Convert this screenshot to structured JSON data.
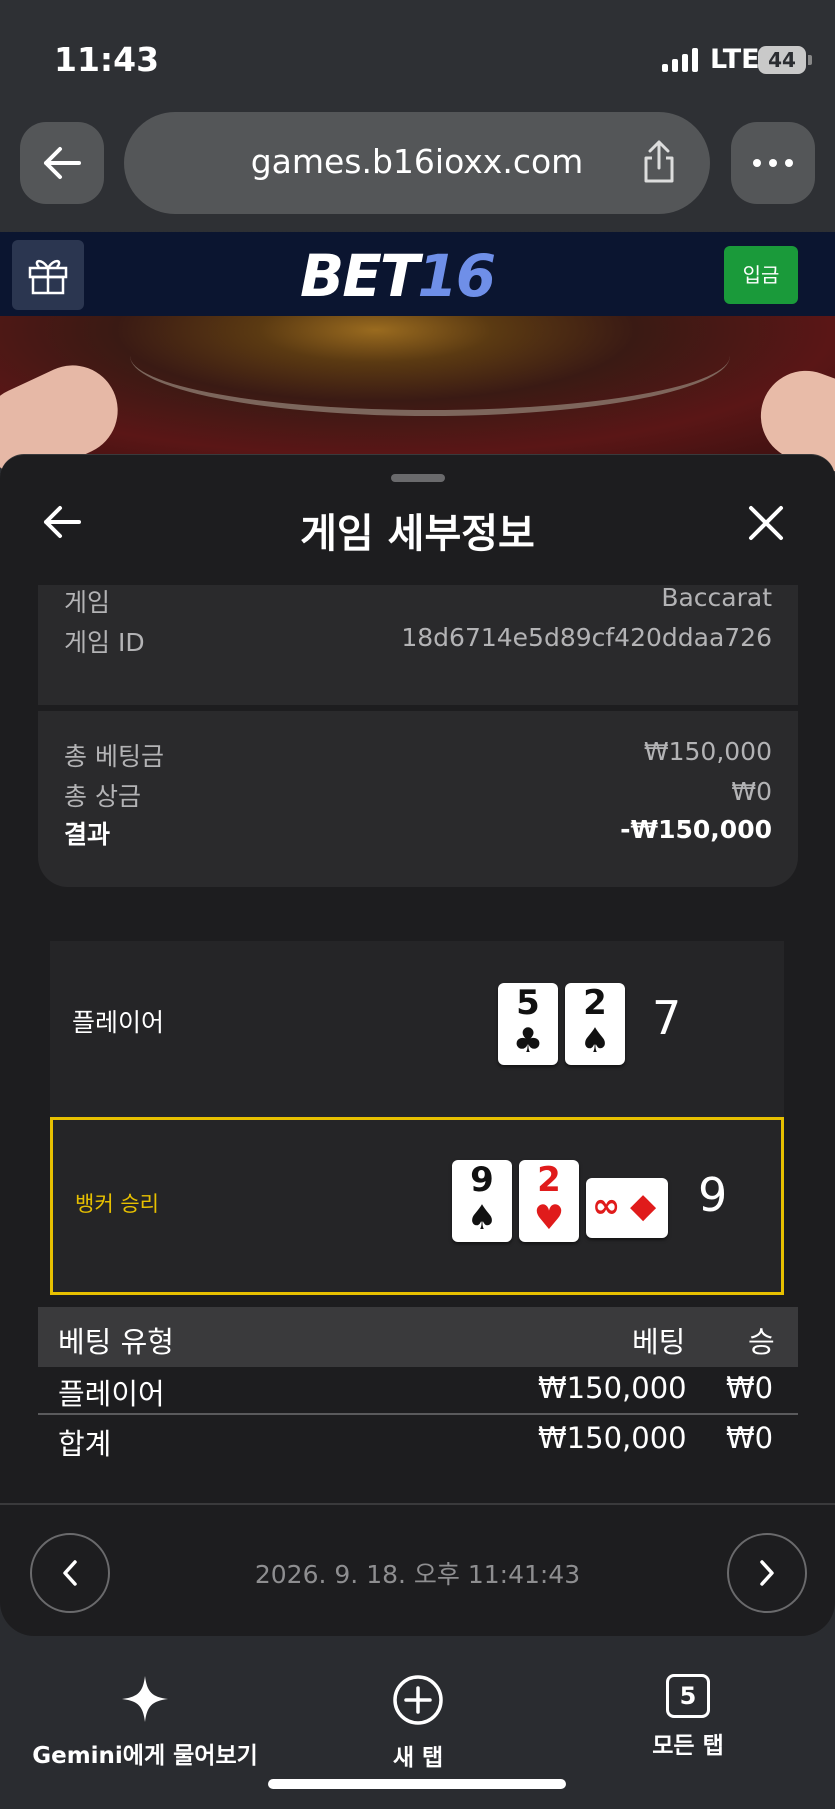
{
  "status_bar": {
    "time": "11:43",
    "network": "LTE",
    "battery": "44"
  },
  "browser": {
    "url": "games.b16ioxx.com"
  },
  "site_header": {
    "logo_main": "BET",
    "logo_num": "16",
    "deposit_label": "입금"
  },
  "sheet": {
    "title": "게임 세부정보",
    "game_label": "게임",
    "game_value": "Baccarat",
    "game_id_label": "게임 ID",
    "game_id_value": "18d6714e5d89cf420ddaa726",
    "total_bet_label": "총 베팅금",
    "total_bet_value": "₩150,000",
    "total_win_label": "총 상금",
    "total_win_value": "₩0",
    "result_label": "결과",
    "result_value": "-₩150,000"
  },
  "hands": {
    "player": {
      "label": "플레이어",
      "score": "7",
      "cards": [
        {
          "rank": "5",
          "suit": "♣"
        },
        {
          "rank": "2",
          "suit": "♠"
        }
      ]
    },
    "banker": {
      "label": "뱅커 승리",
      "score": "9",
      "cards": [
        {
          "rank": "9",
          "suit": "♠"
        },
        {
          "rank": "2",
          "suit": "♥"
        },
        {
          "rank": "∞",
          "suit": "◆"
        }
      ]
    }
  },
  "bet_table": {
    "headers": [
      "베팅 유형",
      "베팅",
      "승"
    ],
    "rows": [
      [
        "플레이어",
        "₩150,000",
        "₩0"
      ],
      [
        "합계",
        "₩150,000",
        "₩0"
      ]
    ]
  },
  "footer": {
    "timestamp": "2026. 9. 18. 오후 11:41:43"
  },
  "bottom_bar": {
    "gemini_label": "Gemini에게 물어보기",
    "new_tab_label": "새 탭",
    "all_tabs_label": "모든 탭",
    "tab_count": "5"
  },
  "colors": {
    "accent_yellow": "#e7c000",
    "deposit_green": "#1a9a3a",
    "header_navy": "#0b1530",
    "card_red": "#e01b1b"
  }
}
